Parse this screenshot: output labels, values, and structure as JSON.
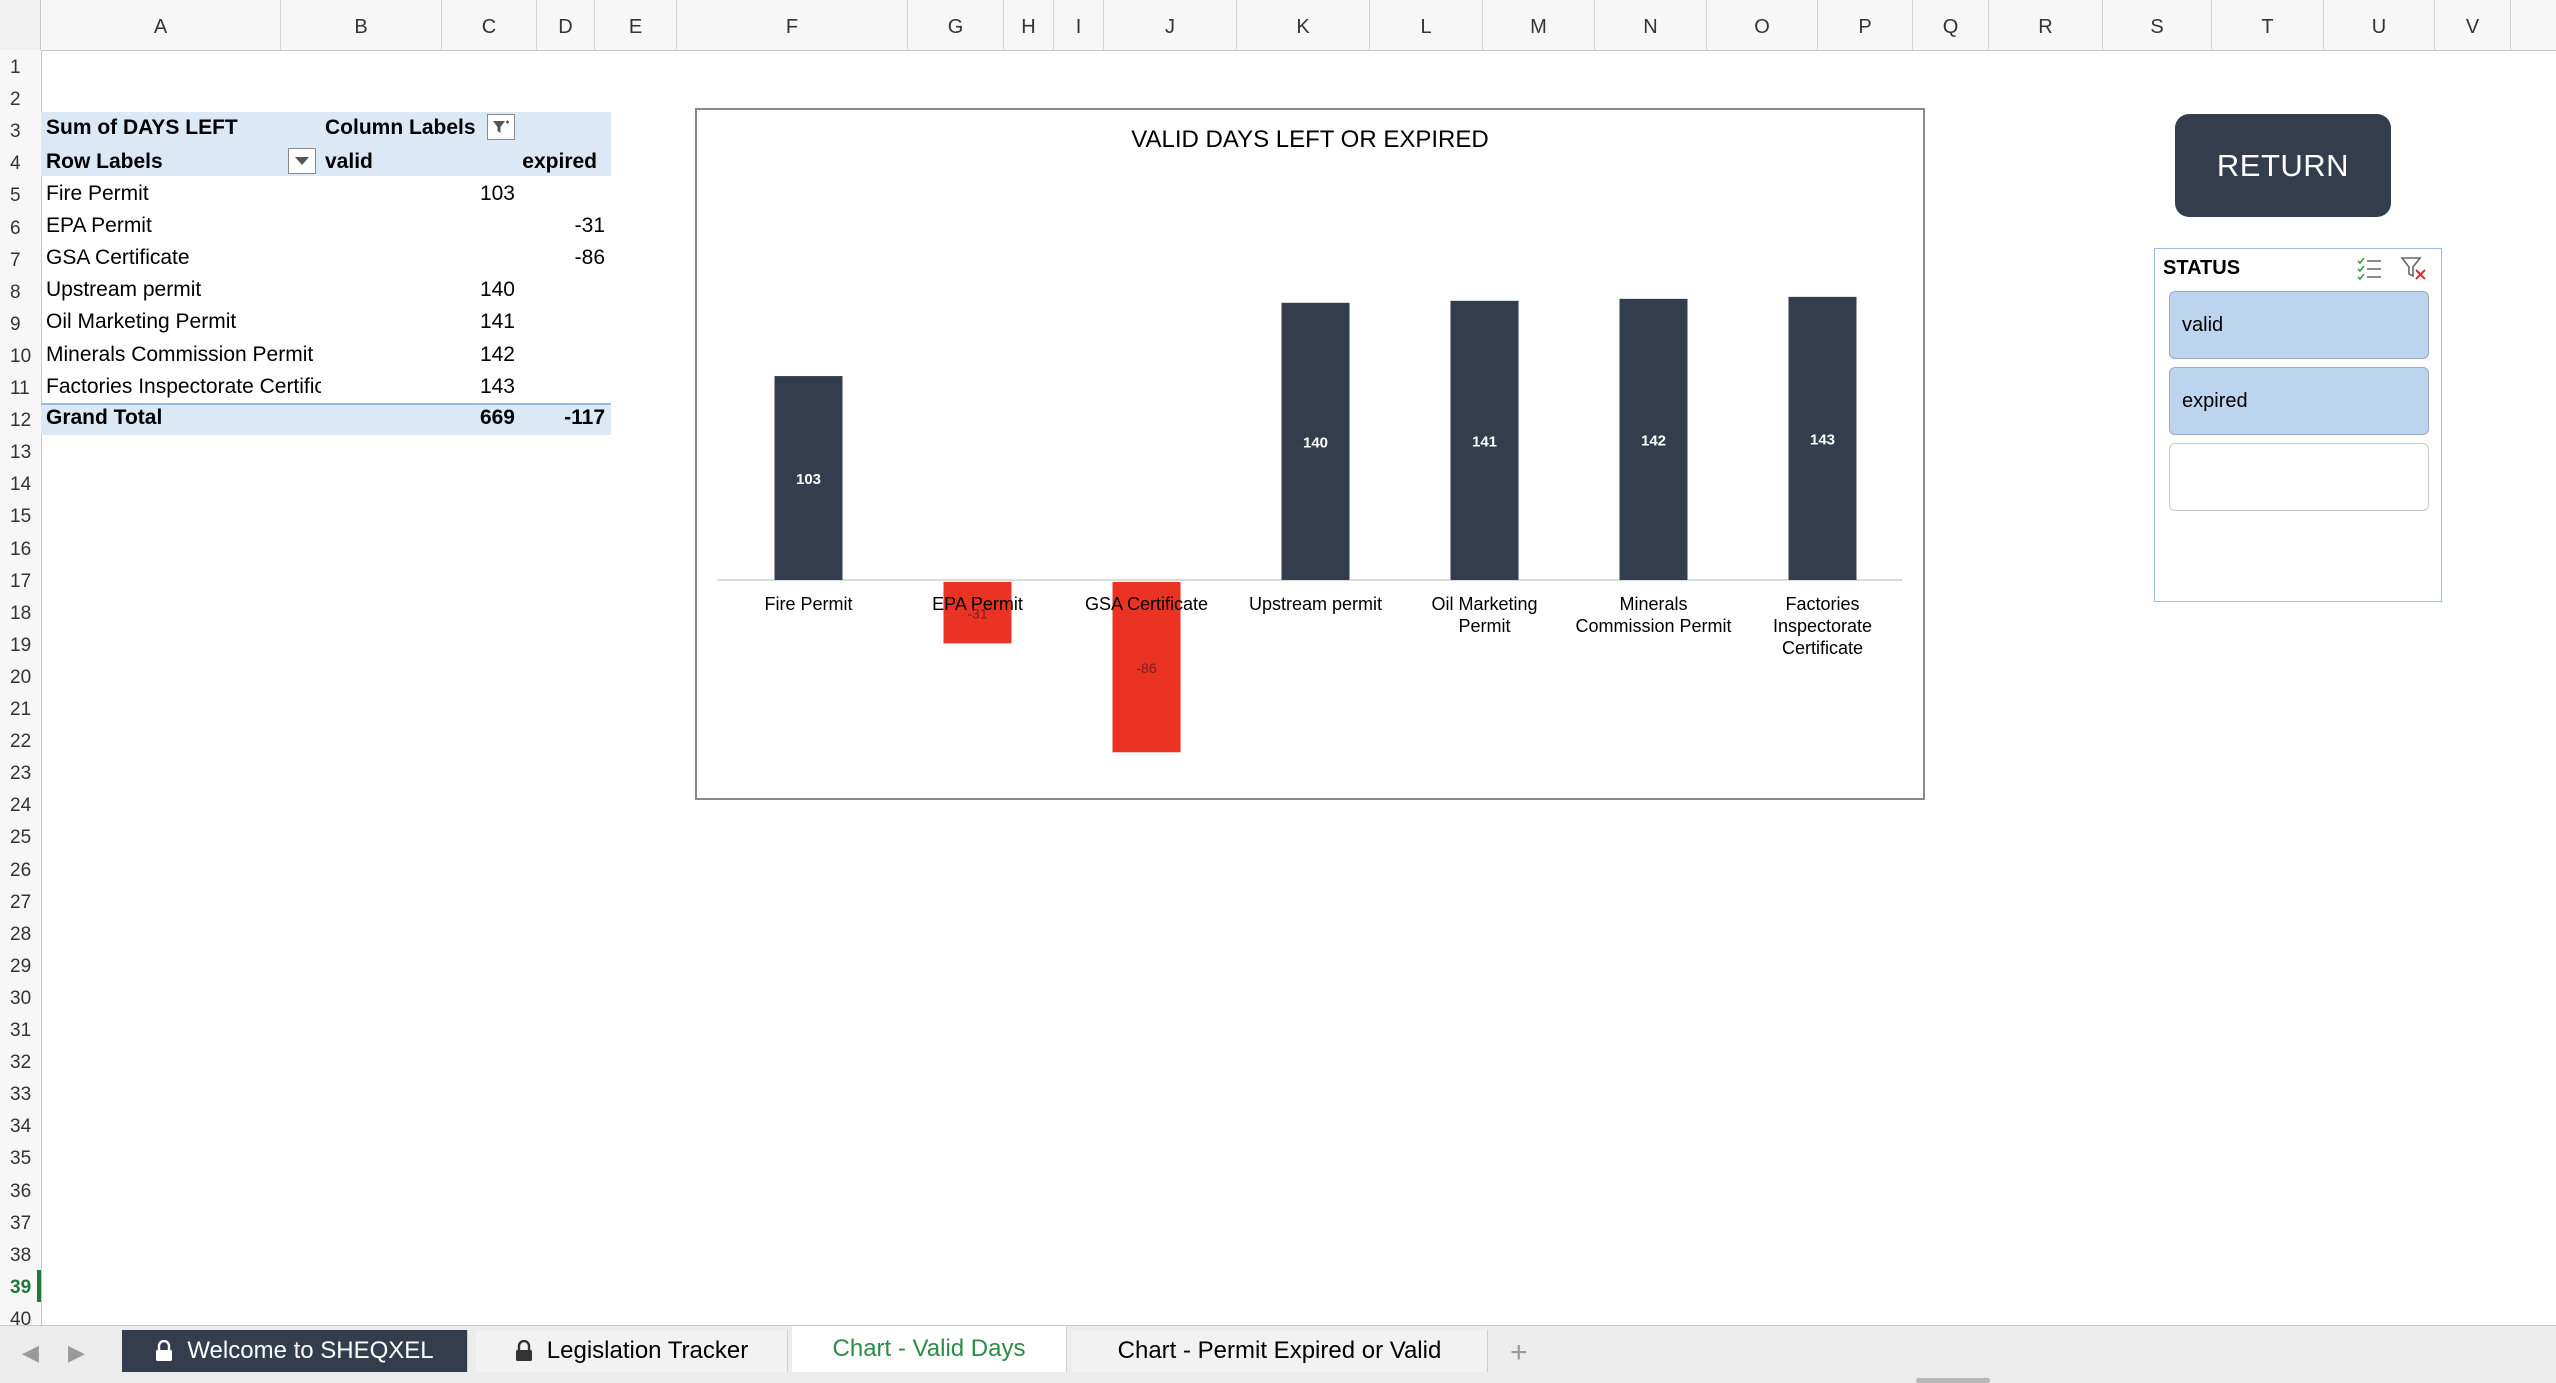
{
  "columns": [
    "A",
    "B",
    "C",
    "D",
    "E",
    "F",
    "G",
    "H",
    "I",
    "J",
    "K",
    "L",
    "M",
    "N",
    "O",
    "P",
    "Q",
    "R",
    "S",
    "T",
    "U",
    "V"
  ],
  "rows": [
    "1",
    "2",
    "3",
    "4",
    "5",
    "6",
    "7",
    "8",
    "9",
    "10",
    "11",
    "12",
    "13",
    "14",
    "15",
    "16",
    "17",
    "18",
    "19",
    "20",
    "21",
    "22",
    "23",
    "24",
    "25",
    "26",
    "27",
    "28",
    "29",
    "30",
    "31",
    "32",
    "33",
    "34",
    "35",
    "36",
    "37",
    "38",
    "39",
    "40"
  ],
  "active_row": "39",
  "pivot": {
    "header1_label": "Sum of DAYS LEFT",
    "header1_col": "Column Labels",
    "row_labels": "Row Labels",
    "col_valid": "valid",
    "col_expired": "expired",
    "items": [
      {
        "label": "Fire Permit",
        "valid": "103",
        "expired": ""
      },
      {
        "label": "EPA Permit",
        "valid": "",
        "expired": "-31"
      },
      {
        "label": "GSA Certificate",
        "valid": "",
        "expired": "-86"
      },
      {
        "label": "Upstream permit",
        "valid": "140",
        "expired": ""
      },
      {
        "label": "Oil Marketing Permit",
        "valid": "141",
        "expired": ""
      },
      {
        "label": "Minerals Commission Permit",
        "valid": "142",
        "expired": ""
      },
      {
        "label": "Factories Inspectorate Certificate",
        "valid": "143",
        "expired": ""
      }
    ],
    "grand_total_label": "Grand Total",
    "grand_total_valid": "669",
    "grand_total_expired": "-117"
  },
  "chart_data": {
    "type": "bar",
    "title": "VALID DAYS LEFT OR EXPIRED",
    "categories": [
      "Fire Permit",
      "EPA Permit",
      "GSA Certificate",
      "Upstream permit",
      "Oil Marketing Permit",
      "Minerals Commission Permit",
      "Factories Inspectorate Certificate"
    ],
    "category_lines": [
      [
        "Fire Permit"
      ],
      [
        "EPA Permit"
      ],
      [
        "GSA Certificate"
      ],
      [
        "Upstream permit"
      ],
      [
        "Oil Marketing",
        "Permit"
      ],
      [
        "Minerals",
        "Commission Permit"
      ],
      [
        "Factories",
        "Inspectorate",
        "Certificate"
      ]
    ],
    "series": [
      {
        "name": "valid",
        "values": [
          103,
          null,
          null,
          140,
          141,
          142,
          143
        ],
        "color": "#333d4d"
      },
      {
        "name": "expired",
        "values": [
          null,
          -31,
          -86,
          null,
          null,
          null,
          null
        ],
        "color": "#ea3323"
      }
    ],
    "ylim": [
      -100,
      170
    ],
    "grid": false,
    "legend": "none",
    "data_labels": true
  },
  "return_button": {
    "label": "RETURN"
  },
  "slicer": {
    "title": "STATUS",
    "items": [
      {
        "label": "valid",
        "selected": true
      },
      {
        "label": "expired",
        "selected": true
      },
      {
        "label": "",
        "selected": false
      }
    ]
  },
  "tabs": [
    {
      "label": "Welcome to SHEQXEL",
      "locked": true,
      "style": "dark"
    },
    {
      "label": "Legislation Tracker",
      "locked": true,
      "style": "light"
    },
    {
      "label": "Chart - Valid Days",
      "locked": false,
      "style": "active"
    },
    {
      "label": "Chart - Permit Expired or Valid",
      "locked": false,
      "style": "light"
    }
  ],
  "colors": {
    "accent_green": "#2e8b45",
    "dark_navy": "#333d4d",
    "expired_red": "#ea3323",
    "pivot_band": "#dbe8f6"
  }
}
